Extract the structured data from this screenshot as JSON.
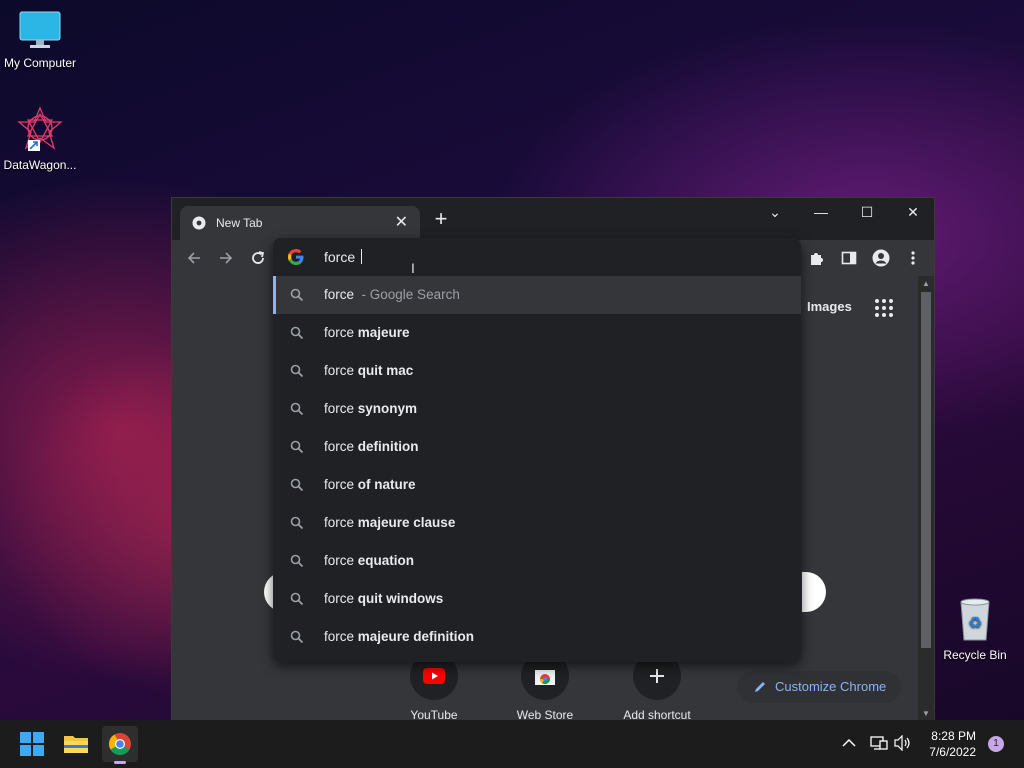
{
  "desktop": {
    "icons": [
      {
        "label": "My Computer"
      },
      {
        "label": "DataWagon..."
      },
      {
        "label": "Recycle Bin"
      }
    ]
  },
  "browser": {
    "tab": {
      "title": "New Tab",
      "close": "✕"
    },
    "newtab_label": "+",
    "window_controls": {
      "dropdown": "⌄",
      "minimize": "—",
      "maximize": "☐",
      "close": "✕"
    },
    "omnibox": {
      "value": "force "
    },
    "suggestions": [
      {
        "prefix": "force",
        "suffix": "",
        "hint": "- Google Search",
        "selected": true
      },
      {
        "prefix": "force ",
        "suffix": "majeure"
      },
      {
        "prefix": "force ",
        "suffix": "quit mac"
      },
      {
        "prefix": "force ",
        "suffix": "synonym"
      },
      {
        "prefix": "force ",
        "suffix": "definition"
      },
      {
        "prefix": "force ",
        "suffix": "of nature"
      },
      {
        "prefix": "force ",
        "suffix": "majeure clause"
      },
      {
        "prefix": "force ",
        "suffix": "equation"
      },
      {
        "prefix": "force ",
        "suffix": "quit windows"
      },
      {
        "prefix": "force ",
        "suffix": "majeure definition"
      }
    ],
    "page": {
      "images_link": "Images",
      "shortcuts": [
        {
          "label": "YouTube"
        },
        {
          "label": "Web Store"
        },
        {
          "label": "Add shortcut"
        }
      ],
      "customize_label": "Customize Chrome"
    }
  },
  "taskbar": {
    "time": "8:28 PM",
    "date": "7/6/2022",
    "notification_count": "1"
  },
  "colors": {
    "accent": "#8ab4f8",
    "chrome_bg": "#35363a",
    "popup_bg": "#202124"
  }
}
